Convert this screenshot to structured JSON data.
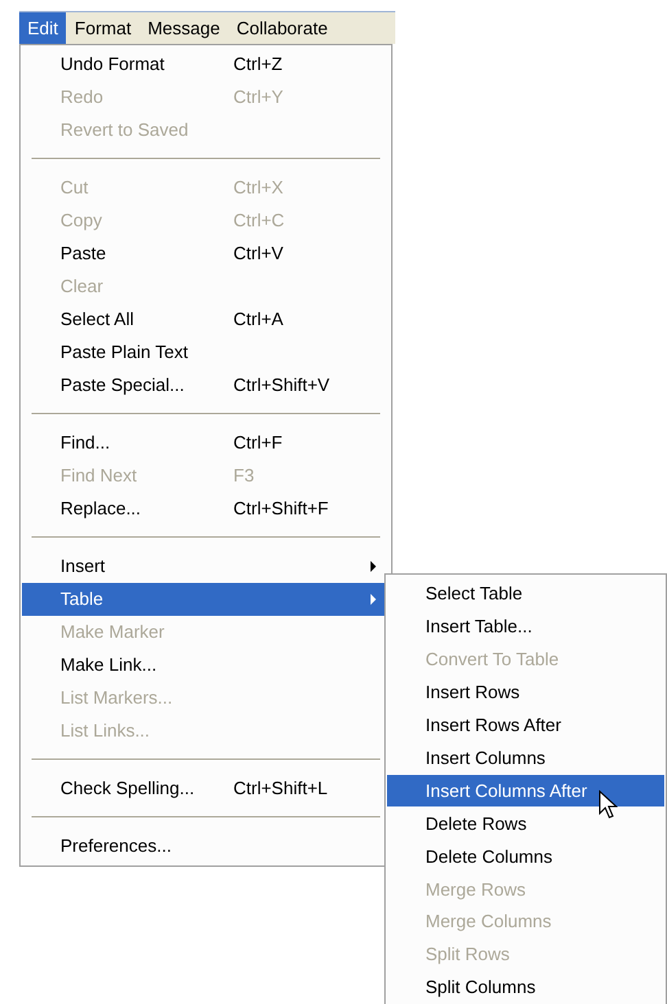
{
  "menubar": [
    {
      "label": "Edit",
      "selected": true
    },
    {
      "label": "Format",
      "selected": false
    },
    {
      "label": "Message",
      "selected": false
    },
    {
      "label": "Collaborate",
      "selected": false
    }
  ],
  "edit_menu": [
    {
      "kind": "item",
      "label": "Undo Format",
      "shortcut": "Ctrl+Z",
      "disabled": false,
      "selected": false
    },
    {
      "kind": "item",
      "label": "Redo",
      "shortcut": "Ctrl+Y",
      "disabled": true,
      "selected": false
    },
    {
      "kind": "item",
      "label": "Revert to Saved",
      "disabled": true,
      "selected": false
    },
    {
      "kind": "separator"
    },
    {
      "kind": "item",
      "label": "Cut",
      "shortcut": "Ctrl+X",
      "disabled": true,
      "selected": false
    },
    {
      "kind": "item",
      "label": "Copy",
      "shortcut": "Ctrl+C",
      "disabled": true,
      "selected": false
    },
    {
      "kind": "item",
      "label": "Paste",
      "shortcut": "Ctrl+V",
      "disabled": false,
      "selected": false
    },
    {
      "kind": "item",
      "label": "Clear",
      "disabled": true,
      "selected": false
    },
    {
      "kind": "item",
      "label": "Select All",
      "shortcut": "Ctrl+A",
      "disabled": false,
      "selected": false
    },
    {
      "kind": "item",
      "label": "Paste Plain Text",
      "disabled": false,
      "selected": false
    },
    {
      "kind": "item",
      "label": "Paste Special...",
      "shortcut": "Ctrl+Shift+V",
      "disabled": false,
      "selected": false
    },
    {
      "kind": "separator"
    },
    {
      "kind": "item",
      "label": "Find...",
      "shortcut": "Ctrl+F",
      "disabled": false,
      "selected": false
    },
    {
      "kind": "item",
      "label": "Find Next",
      "shortcut": "F3",
      "disabled": true,
      "selected": false
    },
    {
      "kind": "item",
      "label": "Replace...",
      "shortcut": "Ctrl+Shift+F",
      "disabled": false,
      "selected": false
    },
    {
      "kind": "separator"
    },
    {
      "kind": "submenu",
      "label": "Insert",
      "disabled": false,
      "selected": false
    },
    {
      "kind": "submenu",
      "label": "Table",
      "disabled": false,
      "selected": true
    },
    {
      "kind": "item",
      "label": "Make Marker",
      "disabled": true,
      "selected": false
    },
    {
      "kind": "item",
      "label": "Make Link...",
      "disabled": false,
      "selected": false
    },
    {
      "kind": "item",
      "label": "List Markers...",
      "disabled": true,
      "selected": false
    },
    {
      "kind": "item",
      "label": "List Links...",
      "disabled": true,
      "selected": false
    },
    {
      "kind": "separator"
    },
    {
      "kind": "item",
      "label": "Check Spelling...",
      "shortcut": "Ctrl+Shift+L",
      "disabled": false,
      "selected": false
    },
    {
      "kind": "separator"
    },
    {
      "kind": "item",
      "label": "Preferences...",
      "disabled": false,
      "selected": false
    }
  ],
  "table_submenu": [
    {
      "label": "Select Table",
      "disabled": false,
      "selected": false
    },
    {
      "label": "Insert Table...",
      "disabled": false,
      "selected": false
    },
    {
      "label": "Convert To Table",
      "disabled": true,
      "selected": false
    },
    {
      "label": "Insert Rows",
      "disabled": false,
      "selected": false
    },
    {
      "label": "Insert Rows After",
      "disabled": false,
      "selected": false
    },
    {
      "label": "Insert Columns",
      "disabled": false,
      "selected": false
    },
    {
      "label": "Insert Columns After",
      "disabled": false,
      "selected": true
    },
    {
      "label": "Delete Rows",
      "disabled": false,
      "selected": false
    },
    {
      "label": "Delete Columns",
      "disabled": false,
      "selected": false
    },
    {
      "label": "Merge Rows",
      "disabled": true,
      "selected": false
    },
    {
      "label": "Merge Columns",
      "disabled": true,
      "selected": false
    },
    {
      "label": "Split Rows",
      "disabled": true,
      "selected": false
    },
    {
      "label": "Split Columns",
      "disabled": false,
      "selected": false
    }
  ]
}
